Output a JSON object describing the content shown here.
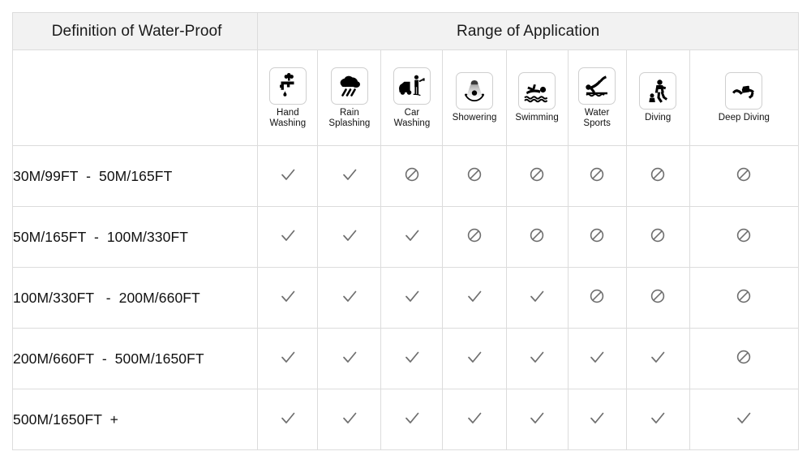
{
  "table": {
    "title_left": "Definition of Water-Proof",
    "title_right": "Range of Application",
    "columns": [
      {
        "key": "hand_washing",
        "icon": "faucet-hand-washing-icon",
        "label": "Hand\nWashing"
      },
      {
        "key": "rain_splashing",
        "icon": "rain-cloud-icon",
        "label": "Rain\nSplashing"
      },
      {
        "key": "car_washing",
        "icon": "car-washing-icon",
        "label": "Car\nWashing"
      },
      {
        "key": "showering",
        "icon": "shower-head-icon",
        "label": "Showering"
      },
      {
        "key": "swimming",
        "icon": "swimmer-icon",
        "label": "Swimming"
      },
      {
        "key": "water_sports",
        "icon": "water-sports-diver-icon",
        "label": "Water\nSports"
      },
      {
        "key": "diving",
        "icon": "scuba-diver-icon",
        "label": "Diving"
      },
      {
        "key": "deep_diving",
        "icon": "deep-diving-icon",
        "label": "Deep Diving"
      }
    ],
    "rows": [
      {
        "range": "30M/99FT  -  50M/165FT",
        "marks": [
          "check",
          "check",
          "no",
          "no",
          "no",
          "no",
          "no",
          "no"
        ]
      },
      {
        "range": "50M/165FT  -  100M/330FT",
        "marks": [
          "check",
          "check",
          "check",
          "no",
          "no",
          "no",
          "no",
          "no"
        ]
      },
      {
        "range": "100M/330FT   -  200M/660FT",
        "marks": [
          "check",
          "check",
          "check",
          "check",
          "check",
          "no",
          "no",
          "no"
        ]
      },
      {
        "range": "200M/660FT  -  500M/1650FT",
        "marks": [
          "check",
          "check",
          "check",
          "check",
          "check",
          "check",
          "check",
          "no"
        ]
      },
      {
        "range": "500M/1650FT  +",
        "marks": [
          "check",
          "check",
          "check",
          "check",
          "check",
          "check",
          "check",
          "check"
        ]
      }
    ],
    "symbols": {
      "check": "check-mark-icon",
      "no": "prohibited-icon"
    },
    "colors": {
      "header_background": "#f2f2f2",
      "border": "#dcdcdc",
      "outer_border": "#d2d2d2",
      "text": "#111111",
      "mark": "#6e6e6e",
      "icon": "#000000",
      "page_background": "#ffffff"
    }
  }
}
